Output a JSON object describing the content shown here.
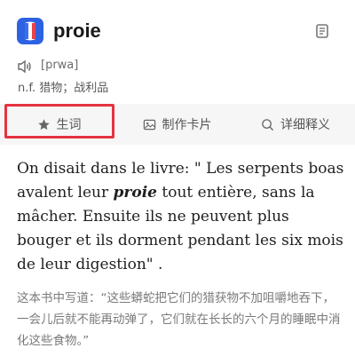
{
  "entry": {
    "word": "proie",
    "phonetic": "[prwa]",
    "definition": "n.f. 猎物；战利品"
  },
  "tabs": [
    {
      "label": "生词",
      "icon": "star-icon"
    },
    {
      "label": "制作卡片",
      "icon": "image-card-icon"
    },
    {
      "label": "详细释义",
      "icon": "search-icon"
    }
  ],
  "example": {
    "en_before": "On disait dans le livre: \" Les serpents boas avalent leur ",
    "en_keyword": "proie",
    "en_after": " tout entière, sans la mâcher. Ensuite ils ne peuvent plus bouger et ils dorment pendant les six mois de leur digestion\" .",
    "zh": "这本书中写道：“这些蟒蛇把它们的猎获物不加咀嚼地吞下，一会儿后就不能再动弹了，它们就在长长的六个月的睡眠中消化这些食物。”"
  },
  "colors": {
    "accent_blue": "#2d63e2",
    "highlight_red": "#e53340",
    "tab_background": "#f6f6f6"
  }
}
